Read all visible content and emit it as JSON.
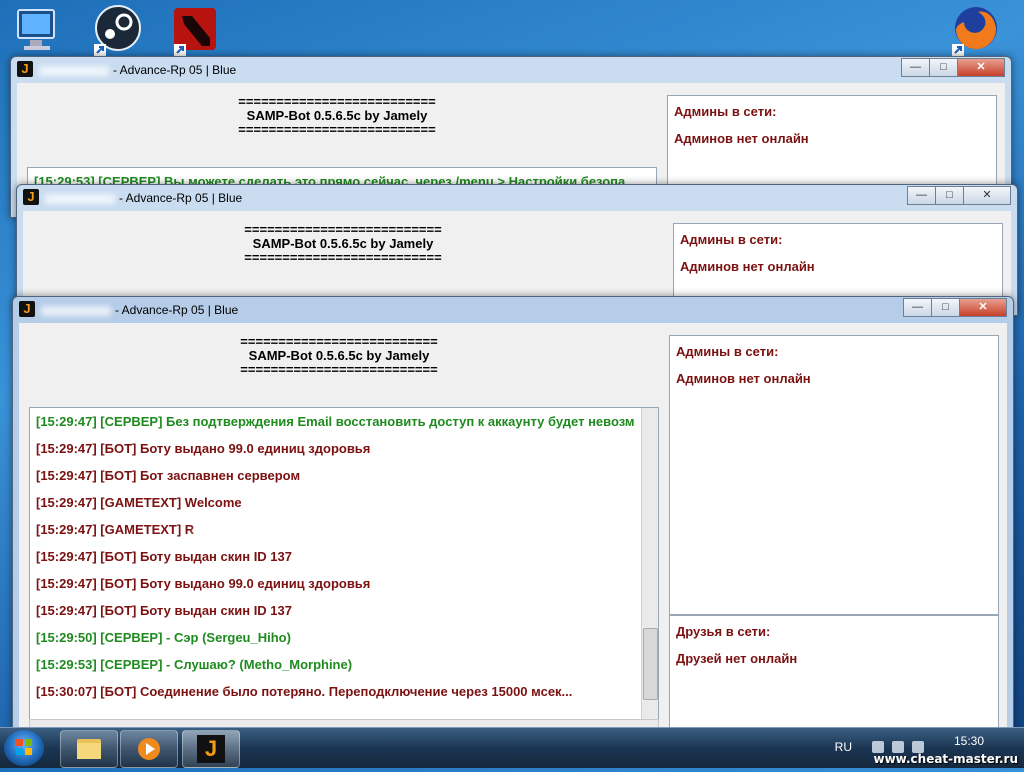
{
  "desktop": {
    "icons": [
      {
        "name": "computer-icon"
      },
      {
        "name": "steam-icon"
      },
      {
        "name": "dota2-icon"
      },
      {
        "name": "firefox-icon"
      }
    ]
  },
  "windows": [
    {
      "title": "- Advance-Rp 05 | Blue",
      "header_line": "==========================",
      "header_title": "SAMP-Bot 0.5.6.5c by Jamely",
      "admins_header": "Админы в сети:",
      "admins_text": "Админов нет онлайн",
      "log_partial": "[15:29:53] [СЕРВЕР] Вы можете сделать это прямо сейчас, через /menu > Настройки безопа"
    },
    {
      "title": "- Advance-Rp 05 | Blue",
      "header_line": "==========================",
      "header_title": "SAMP-Bot 0.5.6.5c by Jamely",
      "admins_header": "Админы в сети:",
      "admins_text": "Админов нет онлайн"
    },
    {
      "title": "- Advance-Rp 05 | Blue",
      "header_line": "==========================",
      "header_title": "SAMP-Bot 0.5.6.5c by Jamely",
      "admins_header": "Админы в сети:",
      "admins_text": "Админов нет онлайн",
      "friends_header": "Друзья в сети:",
      "friends_text": "Друзей нет онлайн",
      "log": [
        {
          "text": "[15:29:47] [СЕРВЕР] Без подтверждения Email восстановить доступ к аккаунту будет невозм",
          "color": "green"
        },
        {
          "text": "[15:29:47] [БОТ] Боту выдано 99.0 единиц здоровья",
          "color": "red"
        },
        {
          "text": "[15:29:47] [БОТ] Бот заспавнен сервером",
          "color": "red"
        },
        {
          "text": "[15:29:47] [GAMETEXT] Welcome",
          "color": "red"
        },
        {
          "text": "[15:29:47] [GAMETEXT] R",
          "color": "red"
        },
        {
          "text": "[15:29:47] [БОТ] Боту выдан скин ID 137",
          "color": "red"
        },
        {
          "text": "[15:29:47] [БОТ] Боту выдано 99.0 единиц здоровья",
          "color": "red"
        },
        {
          "text": "[15:29:47] [БОТ] Боту выдан скин ID 137",
          "color": "red"
        },
        {
          "text": "[15:29:50] [СЕРВЕР] - Сэр (Sergeu_Hiho)",
          "color": "green"
        },
        {
          "text": "[15:29:53] [СЕРВЕР] - Слушаю? (Metho_Morphine)",
          "color": "green"
        },
        {
          "text": "[15:30:07] [БОТ] Соединение было потеряно. Переподключение через 15000 мсек...",
          "color": "red"
        }
      ]
    }
  ],
  "window_controls": {
    "minimize": "—",
    "maximize": "□",
    "close": "✕"
  },
  "taskbar": {
    "language": "RU",
    "time": "15:30",
    "watermark": "www.cheat-master.ru",
    "buttons": [
      {
        "name": "explorer-task-icon"
      },
      {
        "name": "media-player-task-icon"
      },
      {
        "name": "sampbot-task-icon",
        "label": "J"
      }
    ]
  },
  "colors": {
    "log_green": "#1f8b1f",
    "log_red": "#7b1111",
    "accent_icon": "#f39a16"
  }
}
